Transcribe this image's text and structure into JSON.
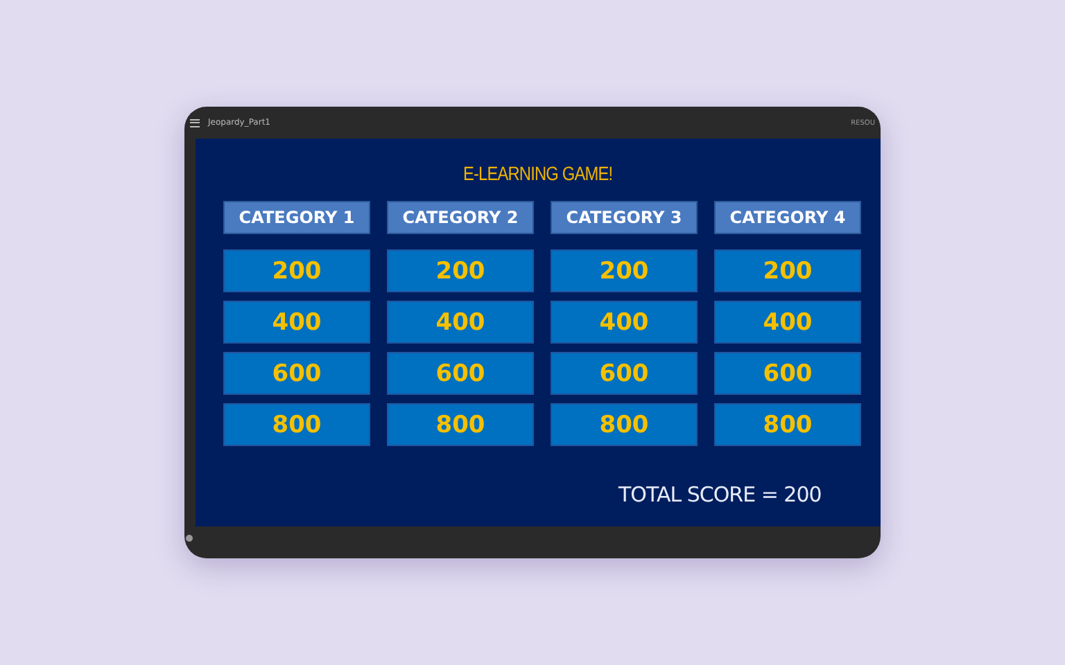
{
  "window": {
    "title": "Jeopardy_Part1",
    "right_label": "RESOU"
  },
  "slide": {
    "title": "E-LEARNING GAME!",
    "categories": [
      {
        "name": "CATEGORY 1",
        "values": [
          "200",
          "400",
          "600",
          "800"
        ]
      },
      {
        "name": "CATEGORY 2",
        "values": [
          "200",
          "400",
          "600",
          "800"
        ]
      },
      {
        "name": "CATEGORY 3",
        "values": [
          "200",
          "400",
          "600",
          "800"
        ]
      },
      {
        "name": "CATEGORY 4",
        "values": [
          "200",
          "400",
          "600",
          "800"
        ]
      }
    ],
    "total_score": "TOTAL SCORE = 200"
  }
}
